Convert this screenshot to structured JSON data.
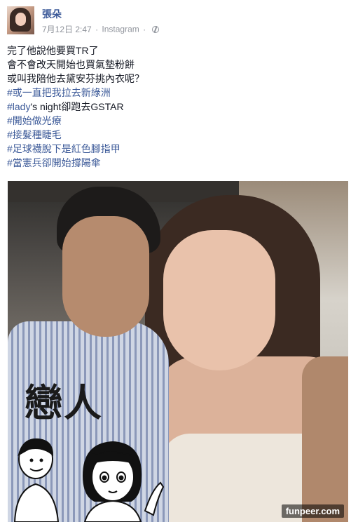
{
  "post": {
    "author": "張朵",
    "date": "7月12日 2:47",
    "separator": "·",
    "source": "Instagram",
    "privacy_icon": "globe-icon",
    "lines": [
      {
        "text": "完了他說他要買TR了",
        "hashtag": false
      },
      {
        "text": "會不會改天開始也買氣墊粉餅",
        "hashtag": false
      },
      {
        "text": "或叫我陪他去黛安芬挑內衣呢？",
        "hashtag": false
      },
      {
        "text": "#或一直把我拉去新綠洲",
        "hashtag": true
      },
      {
        "tag": "#lady",
        "rest": "'s night卻跑去GSTAR",
        "hashtag": "partial"
      },
      {
        "text": "#開始做光療",
        "hashtag": true
      },
      {
        "text": "#接髮種睫毛",
        "hashtag": true
      },
      {
        "text": "#足球襪脫下是紅色腳指甲",
        "hashtag": true
      },
      {
        "text": "#當憲兵卻開始撐陽傘",
        "hashtag": true
      }
    ]
  },
  "photo": {
    "overlay_title": "戀人",
    "watermark": "funpeer.com"
  },
  "colors": {
    "link": "#3b5998",
    "text": "#141823",
    "meta": "#90949c"
  }
}
